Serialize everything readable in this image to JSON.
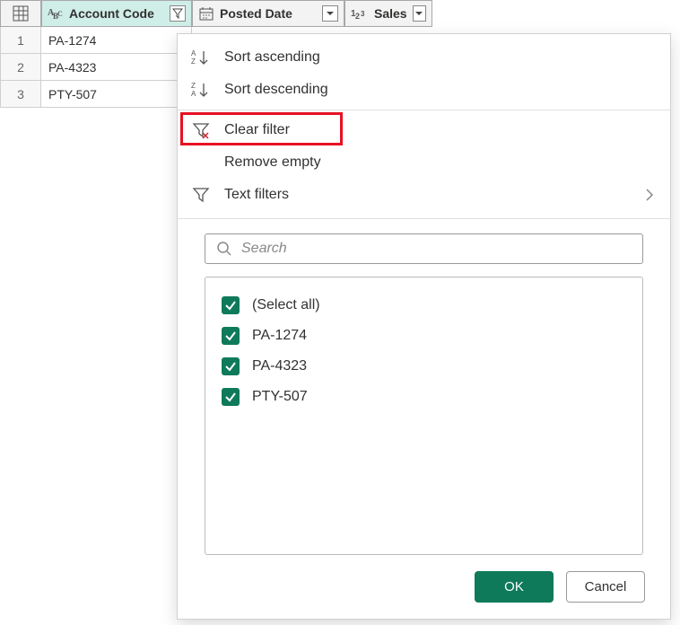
{
  "columns": {
    "account": {
      "label": "Account Code"
    },
    "posted": {
      "label": "Posted Date"
    },
    "sales": {
      "label": "Sales"
    }
  },
  "rows": [
    {
      "num": "1",
      "account": "PA-1274"
    },
    {
      "num": "2",
      "account": "PA-4323"
    },
    {
      "num": "3",
      "account": "PTY-507"
    }
  ],
  "menu": {
    "sort_asc": "Sort ascending",
    "sort_desc": "Sort descending",
    "clear_filter": "Clear filter",
    "remove_empty": "Remove empty",
    "text_filters": "Text filters"
  },
  "search": {
    "placeholder": "Search"
  },
  "checklist": [
    {
      "label": "(Select all)",
      "checked": true
    },
    {
      "label": "PA-1274",
      "checked": true
    },
    {
      "label": "PA-4323",
      "checked": true
    },
    {
      "label": "PTY-507",
      "checked": true
    }
  ],
  "buttons": {
    "ok": "OK",
    "cancel": "Cancel"
  }
}
